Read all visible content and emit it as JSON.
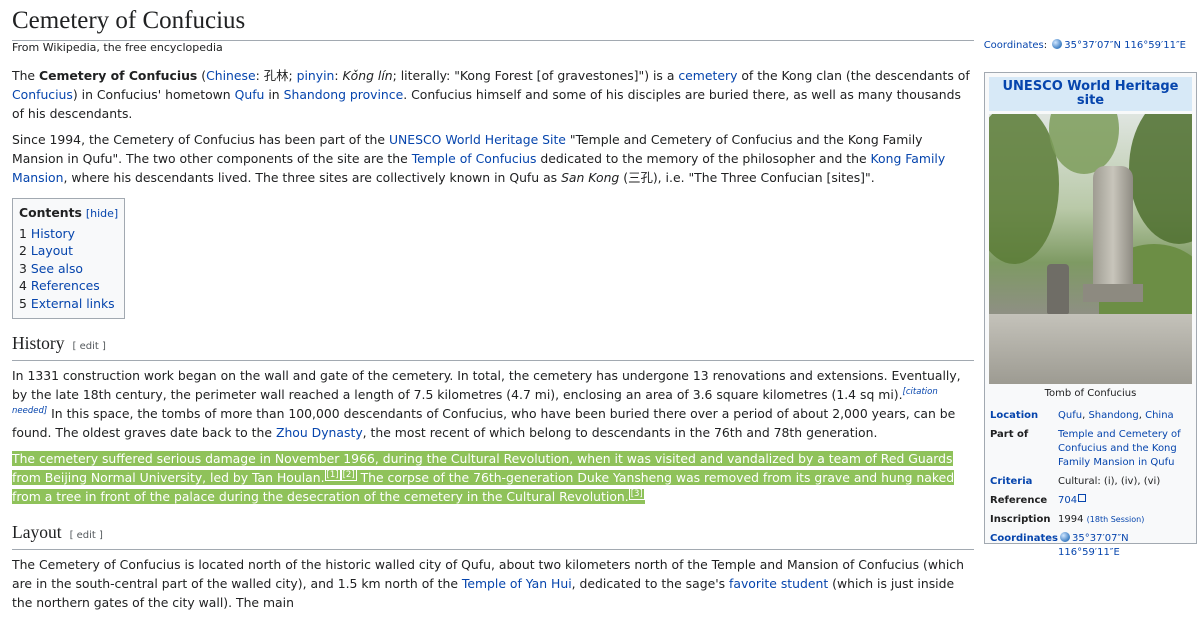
{
  "page": {
    "title": "Cemetery of Confucius",
    "tagline": "From Wikipedia, the free encyclopedia",
    "coordinates_label": "Coordinates",
    "coordinates_value": "35°37′07″N 116°59′11″E"
  },
  "intro": {
    "p1": {
      "t1": "The ",
      "bold": "Cemetery of Confucius",
      "t2": " (",
      "chinese_link": "Chinese",
      "t3": ": 孔林; ",
      "pinyin_link": "pinyin",
      "t4": ": ",
      "pinyin_value": "Kǒng lín",
      "t5": "; literally: \"Kong Forest [of gravestones]\") is a ",
      "cemetery_link": "cemetery",
      "t6": " of the Kong clan (the descendants of ",
      "confucius_link": "Confucius",
      "t7": ") in Confucius' hometown ",
      "qufu_link": "Qufu",
      "t8": " in ",
      "shandong_link": "Shandong province",
      "t9": ". Confucius himself and some of his disciples are buried there, as well as many thousands of his descendants."
    },
    "p2": {
      "t1": "Since 1994, the Cemetery of Confucius has been part of the ",
      "unesco_link": "UNESCO World Heritage Site",
      "t2": " \"Temple and Cemetery of Confucius and the Kong Family Mansion in Qufu\". The two other components of the site are the ",
      "temple_link": "Temple of Confucius",
      "t3": " dedicated to the memory of the philosopher and the ",
      "mansion_link": "Kong Family Mansion",
      "t4": ", where his descendants lived. The three sites are collectively known in Qufu as ",
      "sankong": "San Kong",
      "t5": " (三孔), i.e. \"The Three Confucian [sites]\"."
    }
  },
  "toc": {
    "heading": "Contents",
    "hide": "[hide]",
    "items": [
      {
        "num": "1",
        "label": "History"
      },
      {
        "num": "2",
        "label": "Layout"
      },
      {
        "num": "3",
        "label": "See also"
      },
      {
        "num": "4",
        "label": "References"
      },
      {
        "num": "5",
        "label": "External links"
      }
    ]
  },
  "history": {
    "heading": "History",
    "edit": "[ edit ]",
    "p1": {
      "t1": "In 1331 construction work began on the wall and gate of the cemetery. In total, the cemetery has undergone 13 renovations and extensions. Eventually, by the late 18th century, the perimeter wall reached a length of 7.5 kilometres (4.7 mi), enclosing an area of 3.6 square kilometres (1.4 sq mi).",
      "citation": "[citation needed]",
      "t2": " In this space, the tombs of more than 100,000 descendants of Confucius, who have been buried there over a period of about 2,000 years, can be found. The oldest graves date back to the ",
      "zhou_link": "Zhou Dynasty",
      "t3": ", the most recent of which belong to descendants in the 76th and 78th generation."
    },
    "p2": {
      "t1": "The cemetery suffered serious damage in November 1966, during the Cultural Revolution, when it was visited and vandalized by a team of Red Guards from Beijing Normal University, led by Tan Houlan.",
      "ref1": "[1]",
      "ref2": "[2]",
      "t2": " The corpse of the 76th-generation Duke Yansheng was removed from its grave and hung naked from a tree in front of the palace during the desecration of the cemetery in the Cultural Revolution.",
      "ref3": "[3]"
    }
  },
  "layout": {
    "heading": "Layout",
    "edit": "[ edit ]",
    "p1": {
      "t1": "The Cemetery of Confucius is located north of the historic walled city of Qufu, about two kilometers north of the Temple and Mansion of Confucius (which are in the south-central part of the walled city), and 1.5 km north of the ",
      "yanhui_link": "Temple of Yan Hui",
      "t2": ", dedicated to the sage's ",
      "student_link": "favorite student",
      "t3": " (which is just inside the northern gates of the city wall). The main"
    }
  },
  "infobox": {
    "title": "UNESCO World Heritage site",
    "caption": "Tomb of Confucius",
    "location_label": "Location",
    "location_qufu": "Qufu",
    "location_shandong": "Shandong",
    "location_china": "China",
    "partof_label": "Part of",
    "partof_value": "Temple and Cemetery of Confucius and the Kong Family Mansion in Qufu",
    "criteria_label": "Criteria",
    "criteria_value": "Cultural: (i), (iv), (vi)",
    "reference_label": "Reference",
    "reference_value": "704",
    "inscription_label": "Inscription",
    "inscription_year": "1994",
    "inscription_session": "(18th Session)",
    "coordinates_label": "Coordinates",
    "coordinates_value": "35°37′07″N 116°59′11″E"
  }
}
